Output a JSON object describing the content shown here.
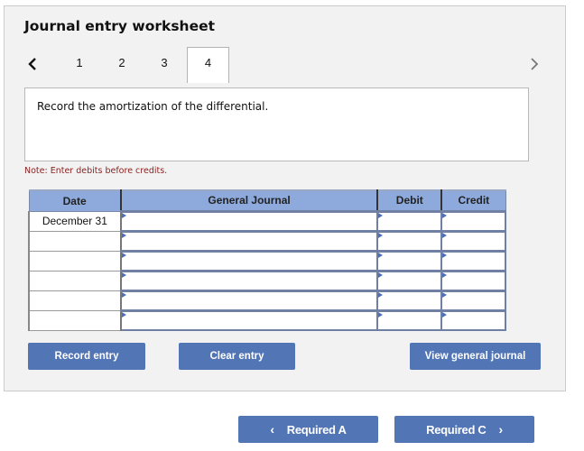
{
  "worksheet": {
    "title": "Journal entry worksheet",
    "tabs": [
      "1",
      "2",
      "3",
      "4"
    ],
    "active_tab": "4",
    "prompt": "Record the amortization of the differential.",
    "note": "Note: Enter debits before credits."
  },
  "table": {
    "headers": {
      "date": "Date",
      "general_journal": "General Journal",
      "debit": "Debit",
      "credit": "Credit"
    },
    "rows": [
      {
        "date": "December 31",
        "account": "",
        "debit": "",
        "credit": ""
      },
      {
        "date": "",
        "account": "",
        "debit": "",
        "credit": ""
      },
      {
        "date": "",
        "account": "",
        "debit": "",
        "credit": ""
      },
      {
        "date": "",
        "account": "",
        "debit": "",
        "credit": ""
      },
      {
        "date": "",
        "account": "",
        "debit": "",
        "credit": ""
      },
      {
        "date": "",
        "account": "",
        "debit": "",
        "credit": ""
      }
    ]
  },
  "buttons": {
    "record_entry": "Record entry",
    "clear_entry": "Clear entry",
    "view_general_journal": "View general journal",
    "required_prev": "Required A",
    "required_next": "Required C"
  },
  "icons": {
    "prev": "chevron-left-icon",
    "next": "chevron-right-icon",
    "dropdown_marker": "triangle-right-icon"
  },
  "colors": {
    "button_bg": "#5275b5",
    "header_bg": "#8eaadc",
    "note_text": "#8b2222",
    "panel_bg": "#f2f2f2"
  }
}
